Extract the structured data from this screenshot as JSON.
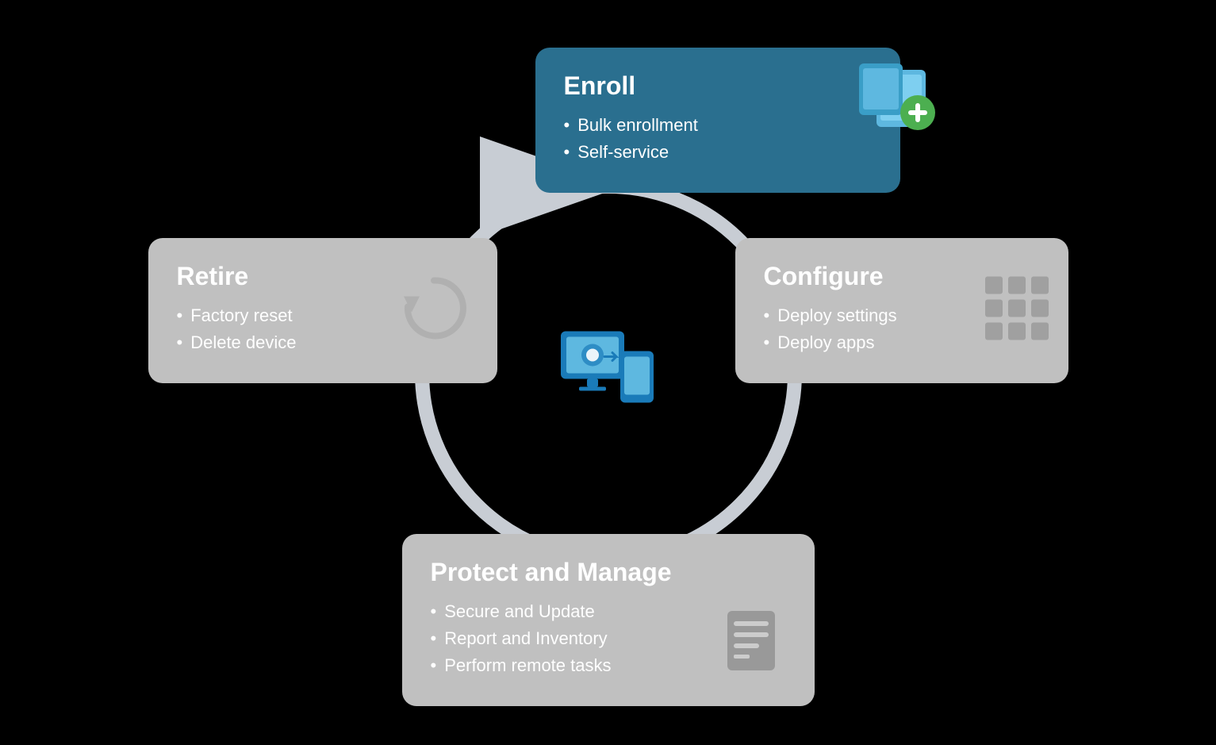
{
  "cards": {
    "enroll": {
      "title": "Enroll",
      "items": [
        "Bulk enrollment",
        "Self-service"
      ]
    },
    "retire": {
      "title": "Retire",
      "items": [
        "Factory reset",
        "Delete device"
      ]
    },
    "configure": {
      "title": "Configure",
      "items": [
        "Deploy settings",
        "Deploy apps"
      ]
    },
    "protect": {
      "title": "Protect and Manage",
      "items": [
        "Secure and Update",
        "Report and Inventory",
        "Perform remote tasks"
      ]
    }
  }
}
